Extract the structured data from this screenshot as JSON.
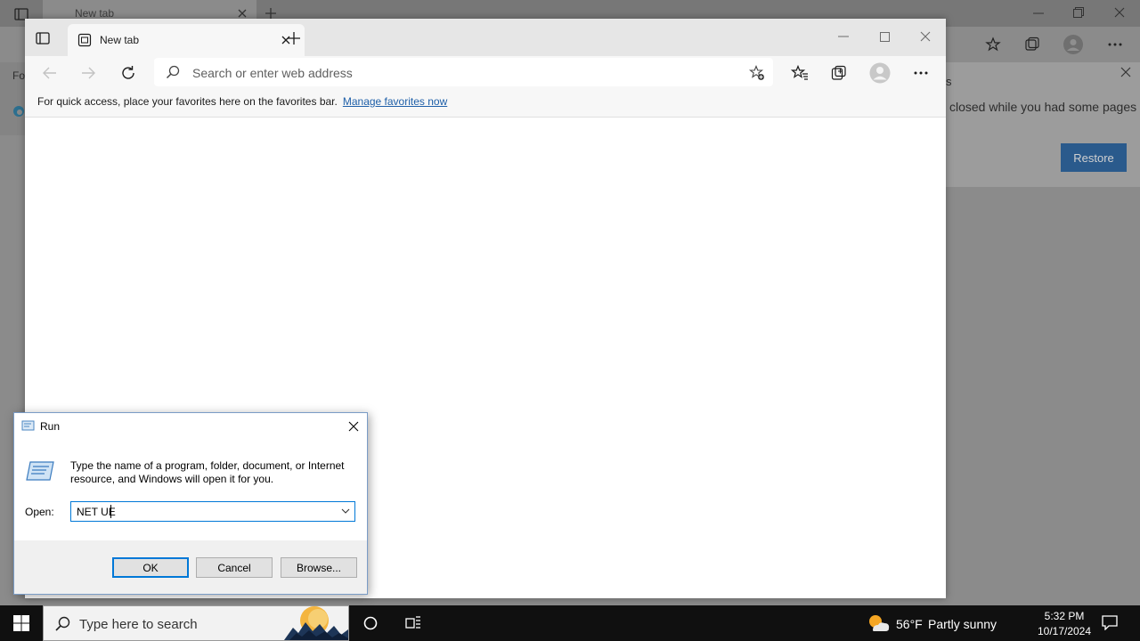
{
  "background_window": {
    "tab_title": "New tab",
    "sidebar_label": "Fo",
    "panel_title_fragment": "s",
    "panel_message": "closed while you had some pages",
    "restore_label": "Restore"
  },
  "browser": {
    "tab_title": "New tab",
    "address_placeholder": "Search or enter web address",
    "favorites_hint": "For quick access, place your favorites here on the favorites bar.",
    "manage_favorites_link": "Manage favorites now"
  },
  "run_dialog": {
    "title": "Run",
    "description": "Type the name of a program, folder, document, or Internet resource, and Windows will open it for you.",
    "open_label": "Open:",
    "open_value": "NET UE",
    "ok_label": "OK",
    "cancel_label": "Cancel",
    "browse_label": "Browse..."
  },
  "taskbar": {
    "search_placeholder": "Type here to search",
    "weather_temp": "56°F",
    "weather_condition": "Partly sunny",
    "time": "5:32 PM",
    "date": "10/17/2024"
  },
  "colors": {
    "accent": "#0078d7",
    "link": "#1e5fa8",
    "taskbar": "#101010"
  }
}
